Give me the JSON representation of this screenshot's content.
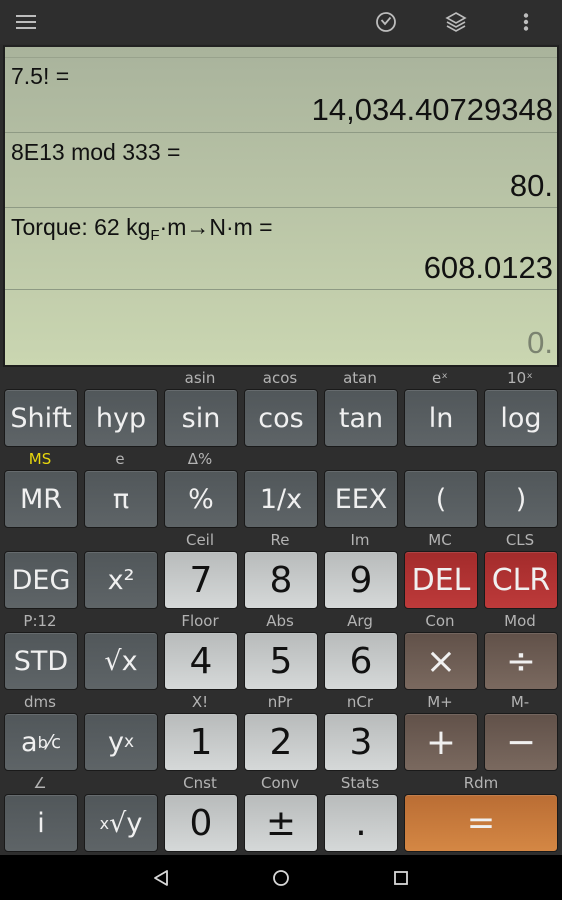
{
  "topbar": {
    "icons": [
      "menu-icon",
      "history-clock-icon",
      "layers-icon",
      "more-vert-icon"
    ]
  },
  "display": {
    "history": [
      {
        "expression": "7.5! =",
        "result": "14,034.40729348"
      },
      {
        "expression": "8E13 mod 333 =",
        "result": "80."
      },
      {
        "expression_parts": {
          "prefix": "Torque: 62 kg",
          "sub": "F",
          "suffix": "·m→N·m ="
        },
        "result": "608.0123"
      }
    ],
    "current_value": "0."
  },
  "keypad": {
    "rows": [
      {
        "labels": [
          "",
          "",
          "asin",
          "acos",
          "atan",
          "eˣ",
          "10ˣ"
        ],
        "keys": [
          "Shift",
          "hyp",
          "sin",
          "cos",
          "tan",
          "ln",
          "log"
        ]
      },
      {
        "labels": [
          "MS",
          "e",
          "Δ%",
          "",
          "",
          "",
          ""
        ],
        "keys": [
          "MR",
          "π",
          "%",
          "1/x",
          "EEX",
          "(",
          ")"
        ]
      },
      {
        "labels": [
          "",
          "",
          "Ceil",
          "Re",
          "Im",
          "MC",
          "CLS"
        ],
        "keys": [
          "DEG",
          "x²",
          "7",
          "8",
          "9",
          "DEL",
          "CLR"
        ]
      },
      {
        "labels": [
          "P:12",
          "",
          "Floor",
          "Abs",
          "Arg",
          "Con",
          "Mod"
        ],
        "keys": [
          "STD",
          "√x",
          "4",
          "5",
          "6",
          "×",
          "÷"
        ]
      },
      {
        "labels": [
          "dms",
          "",
          "X!",
          "nPr",
          "nCr",
          "M+",
          "M-"
        ],
        "keys": [
          "a b/c",
          "yˣ",
          "1",
          "2",
          "3",
          "+",
          "−"
        ]
      },
      {
        "labels": [
          "∠",
          "",
          "Cnst",
          "Conv",
          "Stats",
          "Rdm"
        ],
        "keys": [
          "i",
          "ˣ√y",
          "0",
          "±",
          ".",
          "="
        ]
      }
    ],
    "fraction_key": {
      "a": "a",
      "b": "b",
      "slash": "⁄",
      "c": "c"
    },
    "power_key": {
      "base": "y",
      "exp": "x"
    },
    "root_key": {
      "index": "x",
      "body": "√y"
    },
    "colors": {
      "dark_key": "#5a6063",
      "digit_key": "#c8cbcb",
      "red_key": "#b33333",
      "brown_key": "#705f56",
      "orange_key": "#c97a3b",
      "memory_label": "#e8d70d"
    }
  },
  "navbar": {
    "icons": [
      "back-triangle-icon",
      "home-circle-icon",
      "recents-square-icon"
    ]
  }
}
